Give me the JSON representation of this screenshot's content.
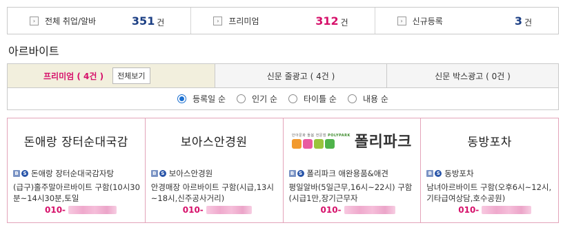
{
  "stats": [
    {
      "label": "전체 취업/알바",
      "count": "351",
      "unit": "건",
      "arrow": "›"
    },
    {
      "label": "프리미엄",
      "count": "312",
      "unit": "건",
      "arrow": "›"
    },
    {
      "label": "신규등록",
      "count": "3",
      "unit": "건",
      "arrow": "›"
    }
  ],
  "colors": {
    "navy": "#1c3f84",
    "pink": "#d6106a",
    "card_border": "#e3a3b9",
    "radio": "#1a6fd1"
  },
  "section_title": "아르바이트",
  "tabs": {
    "premium": "프리미엄 ( 4건 )",
    "view_all": "전체보기",
    "newspaper_line": "신문 줄광고 ( 4건 )",
    "newspaper_box": "신문 박스광고 ( 0건 )"
  },
  "sort": [
    {
      "label": "등록일 순",
      "checked": true
    },
    {
      "label": "인기 순",
      "checked": false
    },
    {
      "label": "타이틀 순",
      "checked": false
    },
    {
      "label": "내용 순",
      "checked": false
    }
  ],
  "icons": {
    "board": "B",
    "company": "S"
  },
  "cards": [
    {
      "logo_text": "돈애랑 장터순대국감",
      "company": "돈애랑 장터순대국감자탕",
      "desc": "(급구)홀주말아르바이트 구함(10시30분~14시30분,토일",
      "phone_prefix": "010-"
    },
    {
      "logo_text": "보아스안경원",
      "company": "보아스안경원",
      "desc": "안경매장 아르바이트 구함(시급,13시~18시,신주공사거리)",
      "phone_prefix": "010-"
    },
    {
      "logo_tagline": "안아문화 돌봄 전문점",
      "logo_brand": "POLYPARK",
      "logo_text": "폴리파크",
      "company": "폴리파크 애완용품&애견",
      "desc": "평일알바(5일근무,16시~22시) 구함(시급1만,장기근무자",
      "phone_prefix": "010-"
    },
    {
      "logo_text": "동방포차",
      "company": "동방포차",
      "desc": "남녀아르바이트 구함(오후6시~12시,기타급여상담,호수공원)",
      "phone_prefix": "010-"
    }
  ]
}
